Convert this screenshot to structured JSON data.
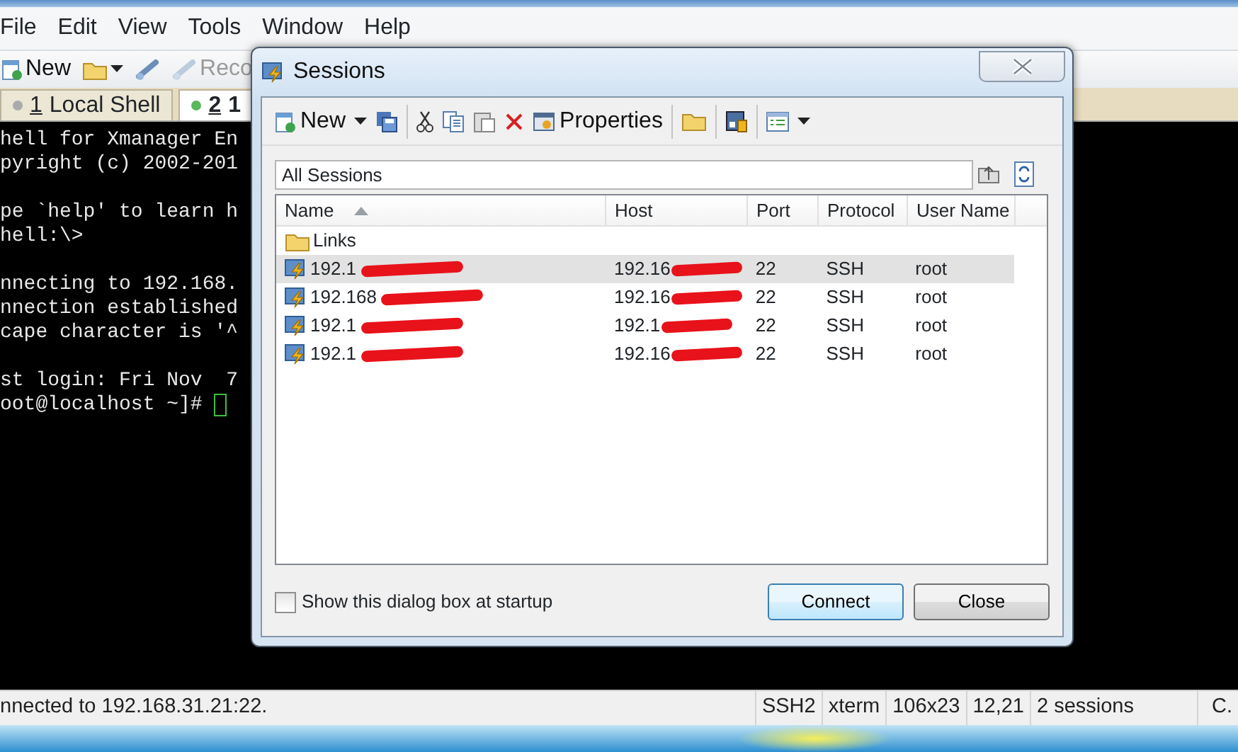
{
  "app": {
    "menu": [
      "File",
      "Edit",
      "View",
      "Tools",
      "Window",
      "Help"
    ],
    "toolbar": [
      {
        "kind": "new",
        "label": "New",
        "disabled": false
      },
      {
        "kind": "open",
        "disabled": false
      },
      {
        "kind": "connect",
        "disabled": false
      },
      {
        "kind": "reconnect",
        "label": "Reco",
        "disabled": true
      }
    ],
    "tabs": [
      {
        "number": "1",
        "label": "Local Shell",
        "selected": false
      },
      {
        "number": "2",
        "label": "1",
        "selected": true
      }
    ],
    "terminal_blocks": [
      [
        "hell for Xmanager En",
        "pyright (c) 2002-201"
      ],
      [
        "pe `help' to learn h",
        "hell:\\>"
      ],
      [
        "nnecting to 192.168.",
        "nnection established",
        "cape character is '^"
      ],
      [
        "st login: Fri Nov  7",
        "oot@localhost ~]# "
      ]
    ],
    "status_bar": {
      "message": "nnected to 192.168.31.21:22.",
      "fields": [
        "SSH2",
        "xterm",
        "106x23",
        "12,21",
        "2 sessions",
        "C."
      ]
    }
  },
  "dialog": {
    "title": "Sessions",
    "toolbar": [
      {
        "kind": "new",
        "label": "New"
      },
      {
        "kind": "caret"
      },
      {
        "kind": "save"
      },
      {
        "kind": "sep"
      },
      {
        "kind": "cut"
      },
      {
        "kind": "copy"
      },
      {
        "kind": "paste"
      },
      {
        "kind": "delete"
      },
      {
        "kind": "properties",
        "label": "Properties"
      },
      {
        "kind": "sep"
      },
      {
        "kind": "folder"
      },
      {
        "kind": "sep"
      },
      {
        "kind": "security"
      },
      {
        "kind": "sep"
      },
      {
        "kind": "view"
      },
      {
        "kind": "caret"
      }
    ],
    "address": "All Sessions",
    "columns": [
      {
        "label": "Name",
        "sorted": true
      },
      {
        "label": "Host",
        "sorted": false
      },
      {
        "label": "Port",
        "sorted": false
      },
      {
        "label": "Protocol",
        "sorted": false
      },
      {
        "label": "User Name",
        "sorted": false
      }
    ],
    "rows": [
      {
        "kind": "folder",
        "name": "Links",
        "selected": false
      },
      {
        "kind": "session",
        "name": "192.1",
        "host": "192.16",
        "port": "22",
        "protocol": "SSH",
        "user": "root",
        "redacted": true,
        "selected": true
      },
      {
        "kind": "session",
        "name": "192.168",
        "host": "192.16",
        "port": "22",
        "protocol": "SSH",
        "user": "root",
        "redacted": true,
        "selected": false
      },
      {
        "kind": "session",
        "name": "192.1",
        "host": "192.1",
        "port": "22",
        "protocol": "SSH",
        "user": "root",
        "redacted": true,
        "selected": false
      },
      {
        "kind": "session",
        "name": "192.1",
        "host": "192.16",
        "port": "22",
        "protocol": "SSH",
        "user": "root",
        "redacted": true,
        "selected": false
      }
    ],
    "startup_checkbox": {
      "label": "Show this dialog box at startup",
      "checked": false
    },
    "buttons": [
      {
        "label": "Connect",
        "default": true
      },
      {
        "label": "Close",
        "default": false
      }
    ]
  }
}
